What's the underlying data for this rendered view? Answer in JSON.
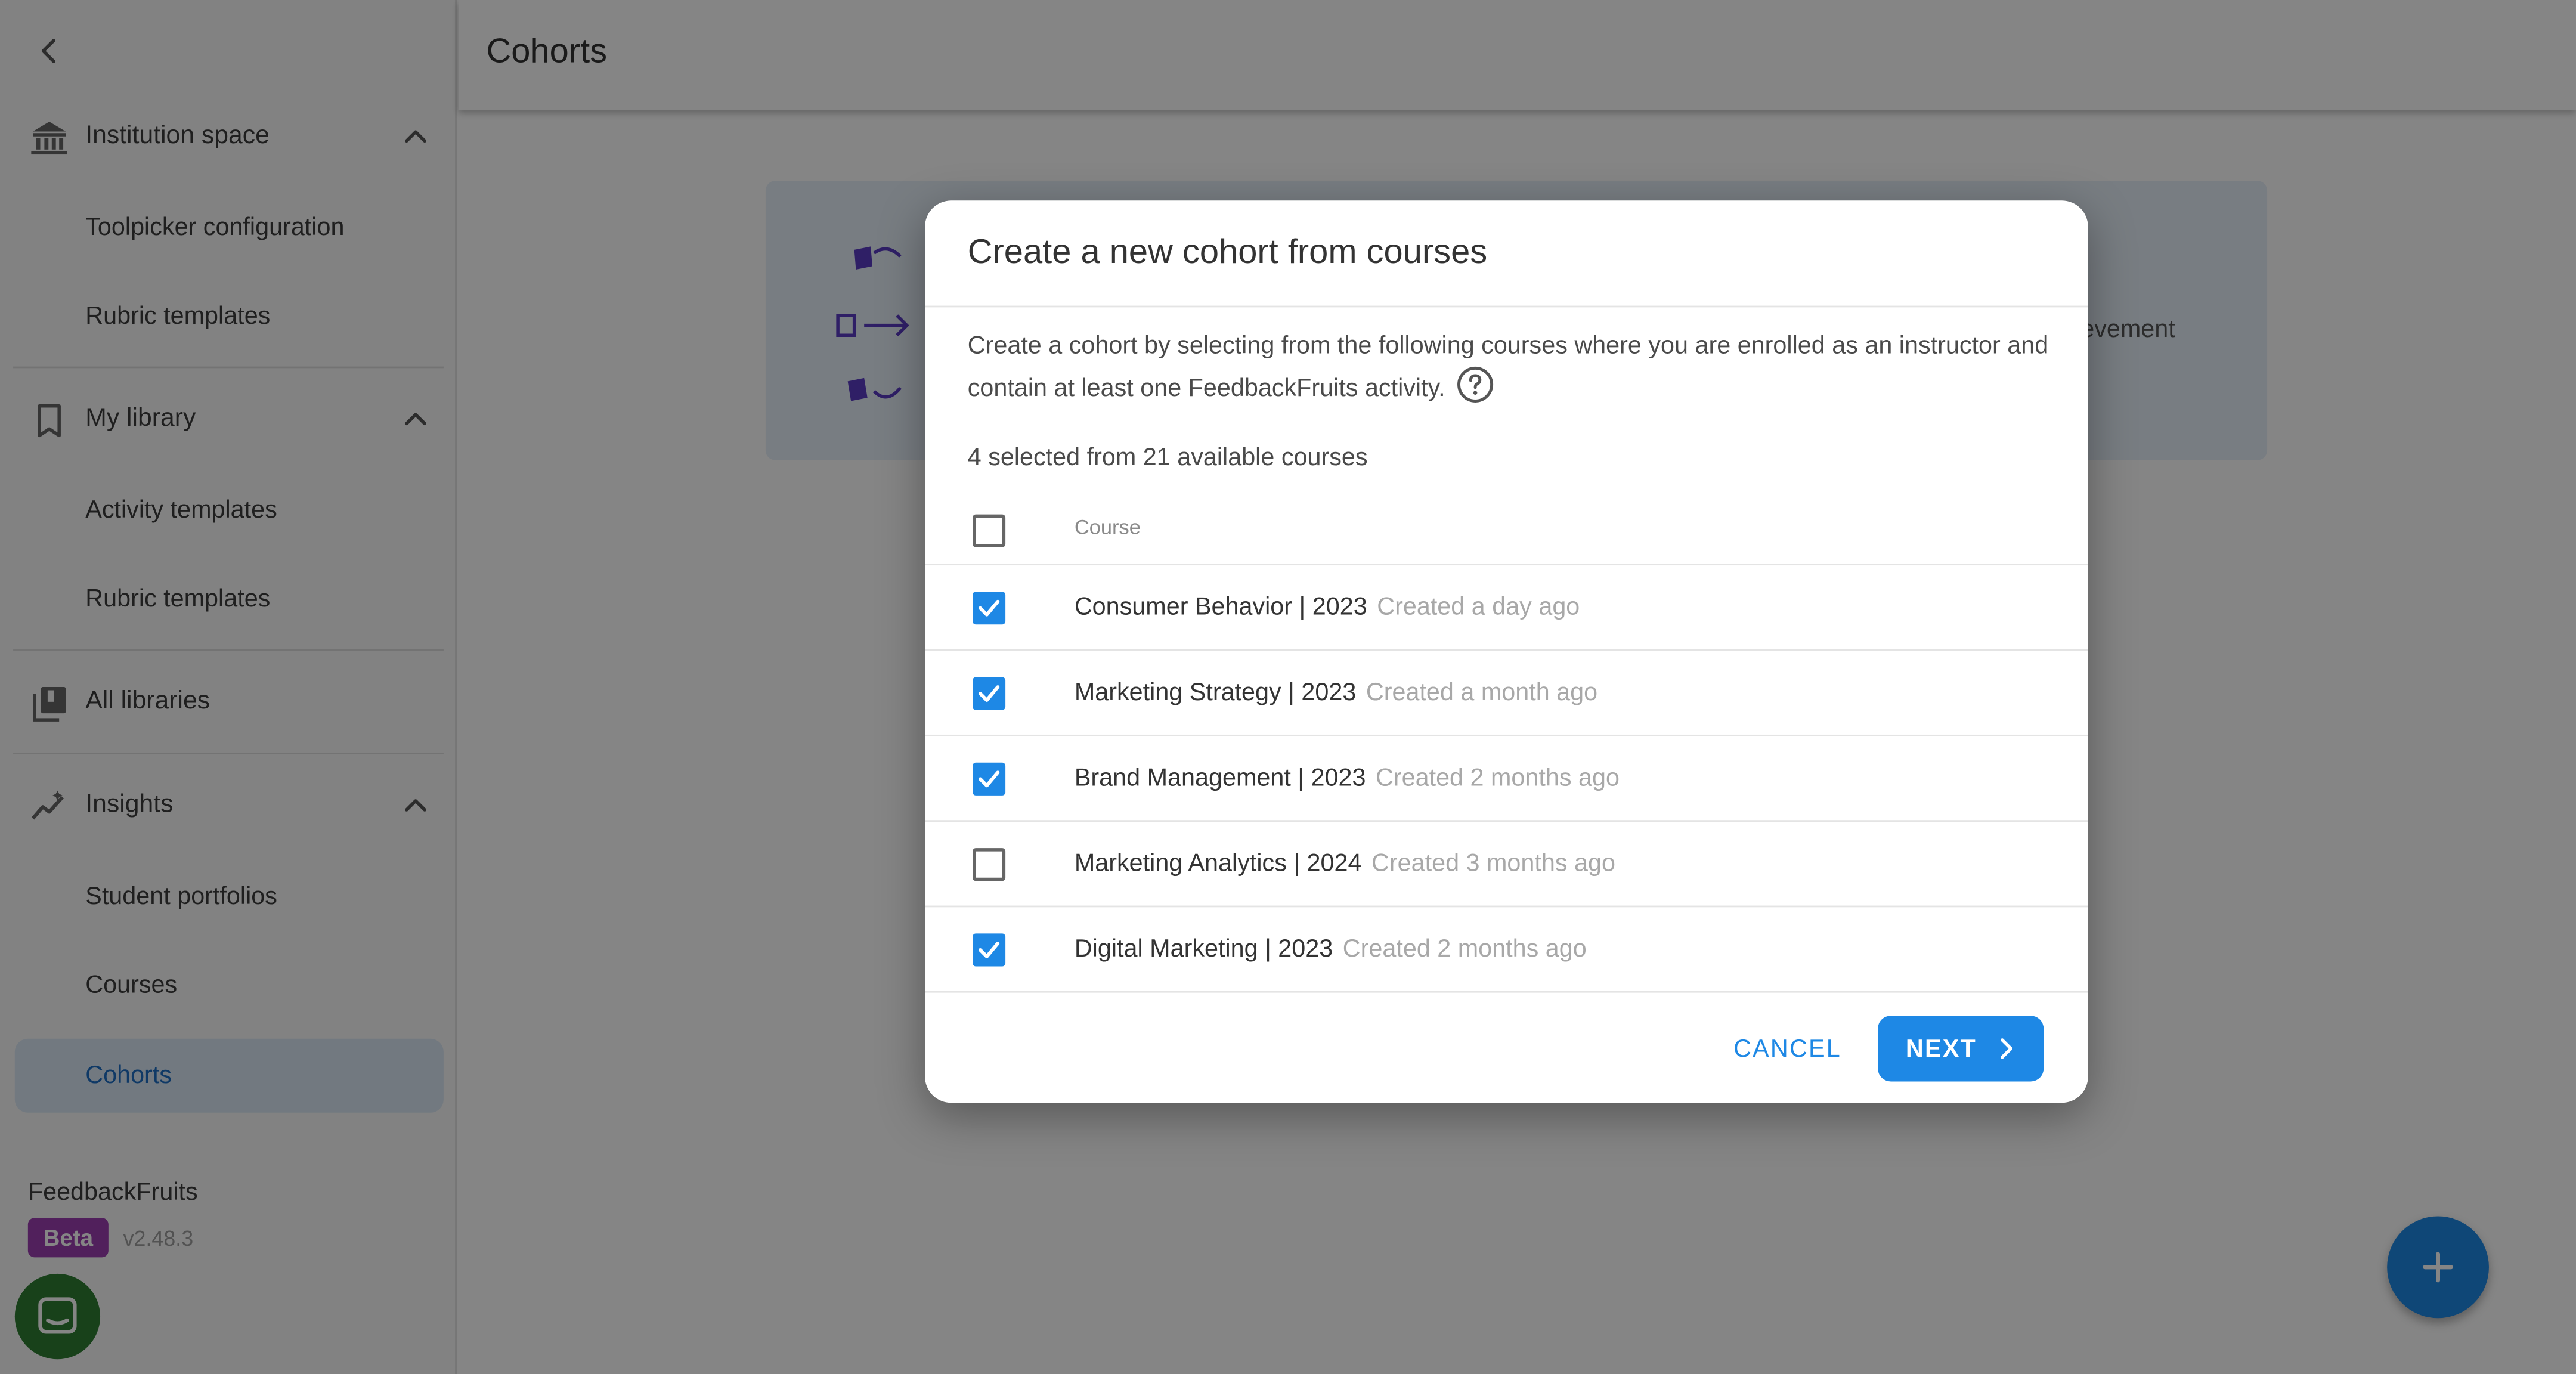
{
  "sidebar": {
    "groups": [
      {
        "label": "Institution space",
        "icon": "institution-icon",
        "items": [
          "Toolpicker configuration",
          "Rubric templates"
        ]
      },
      {
        "label": "My library",
        "icon": "bookmark-icon",
        "items": [
          "Activity templates",
          "Rubric templates"
        ]
      },
      {
        "label": "All libraries",
        "icon": "libraries-icon",
        "items": []
      },
      {
        "label": "Insights",
        "icon": "insights-icon",
        "items": [
          "Student portfolios",
          "Courses",
          "Cohorts"
        ]
      }
    ],
    "active_item": "Cohorts",
    "brand": "FeedbackFruits",
    "beta_badge": "Beta",
    "version": "v2.48.3"
  },
  "header": {
    "title": "Cohorts"
  },
  "banner": {
    "partial_text": "evement"
  },
  "dialog": {
    "title": "Create a new cohort from courses",
    "description": "Create a cohort by selecting from the following courses where you are enrolled as an instructor and contain at least one FeedbackFruits activity.",
    "selection_count": "4 selected from 21 available courses",
    "column_header": "Course",
    "courses": [
      {
        "name": "Consumer Behavior | 2023",
        "created": "Created a day ago",
        "checked": true
      },
      {
        "name": "Marketing Strategy | 2023",
        "created": "Created a month ago",
        "checked": true
      },
      {
        "name": "Brand Management | 2023",
        "created": "Created 2 months ago",
        "checked": true
      },
      {
        "name": "Marketing Analytics | 2024",
        "created": "Created 3 months ago",
        "checked": false
      },
      {
        "name": "Digital Marketing | 2023",
        "created": "Created 2 months ago",
        "checked": true
      }
    ],
    "cancel_label": "CANCEL",
    "next_label": "NEXT"
  },
  "colors": {
    "primary": "#1e88e5",
    "beta": "#9c3fb0",
    "active_bg": "#dbe8f5",
    "chat": "#2e7d32"
  }
}
